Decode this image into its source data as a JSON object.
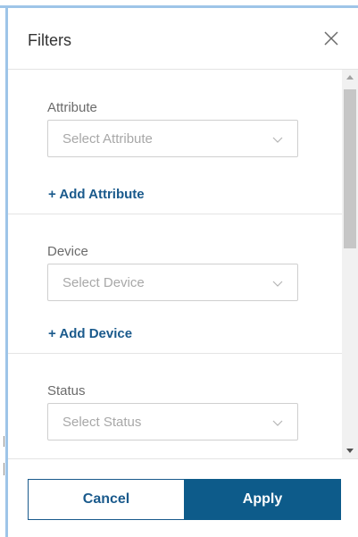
{
  "panel": {
    "title": "Filters"
  },
  "sections": {
    "attribute": {
      "label": "Attribute",
      "placeholder": "Select Attribute",
      "add_label": "+ Add Attribute"
    },
    "device": {
      "label": "Device",
      "placeholder": "Select Device",
      "add_label": "+ Add Device"
    },
    "status": {
      "label": "Status",
      "placeholder": "Select Status"
    }
  },
  "footer": {
    "cancel_label": "Cancel",
    "apply_label": "Apply"
  },
  "colors": {
    "accent": "#0d5b8a",
    "link": "#1a5a8c",
    "frame": "#9ec5e8"
  }
}
